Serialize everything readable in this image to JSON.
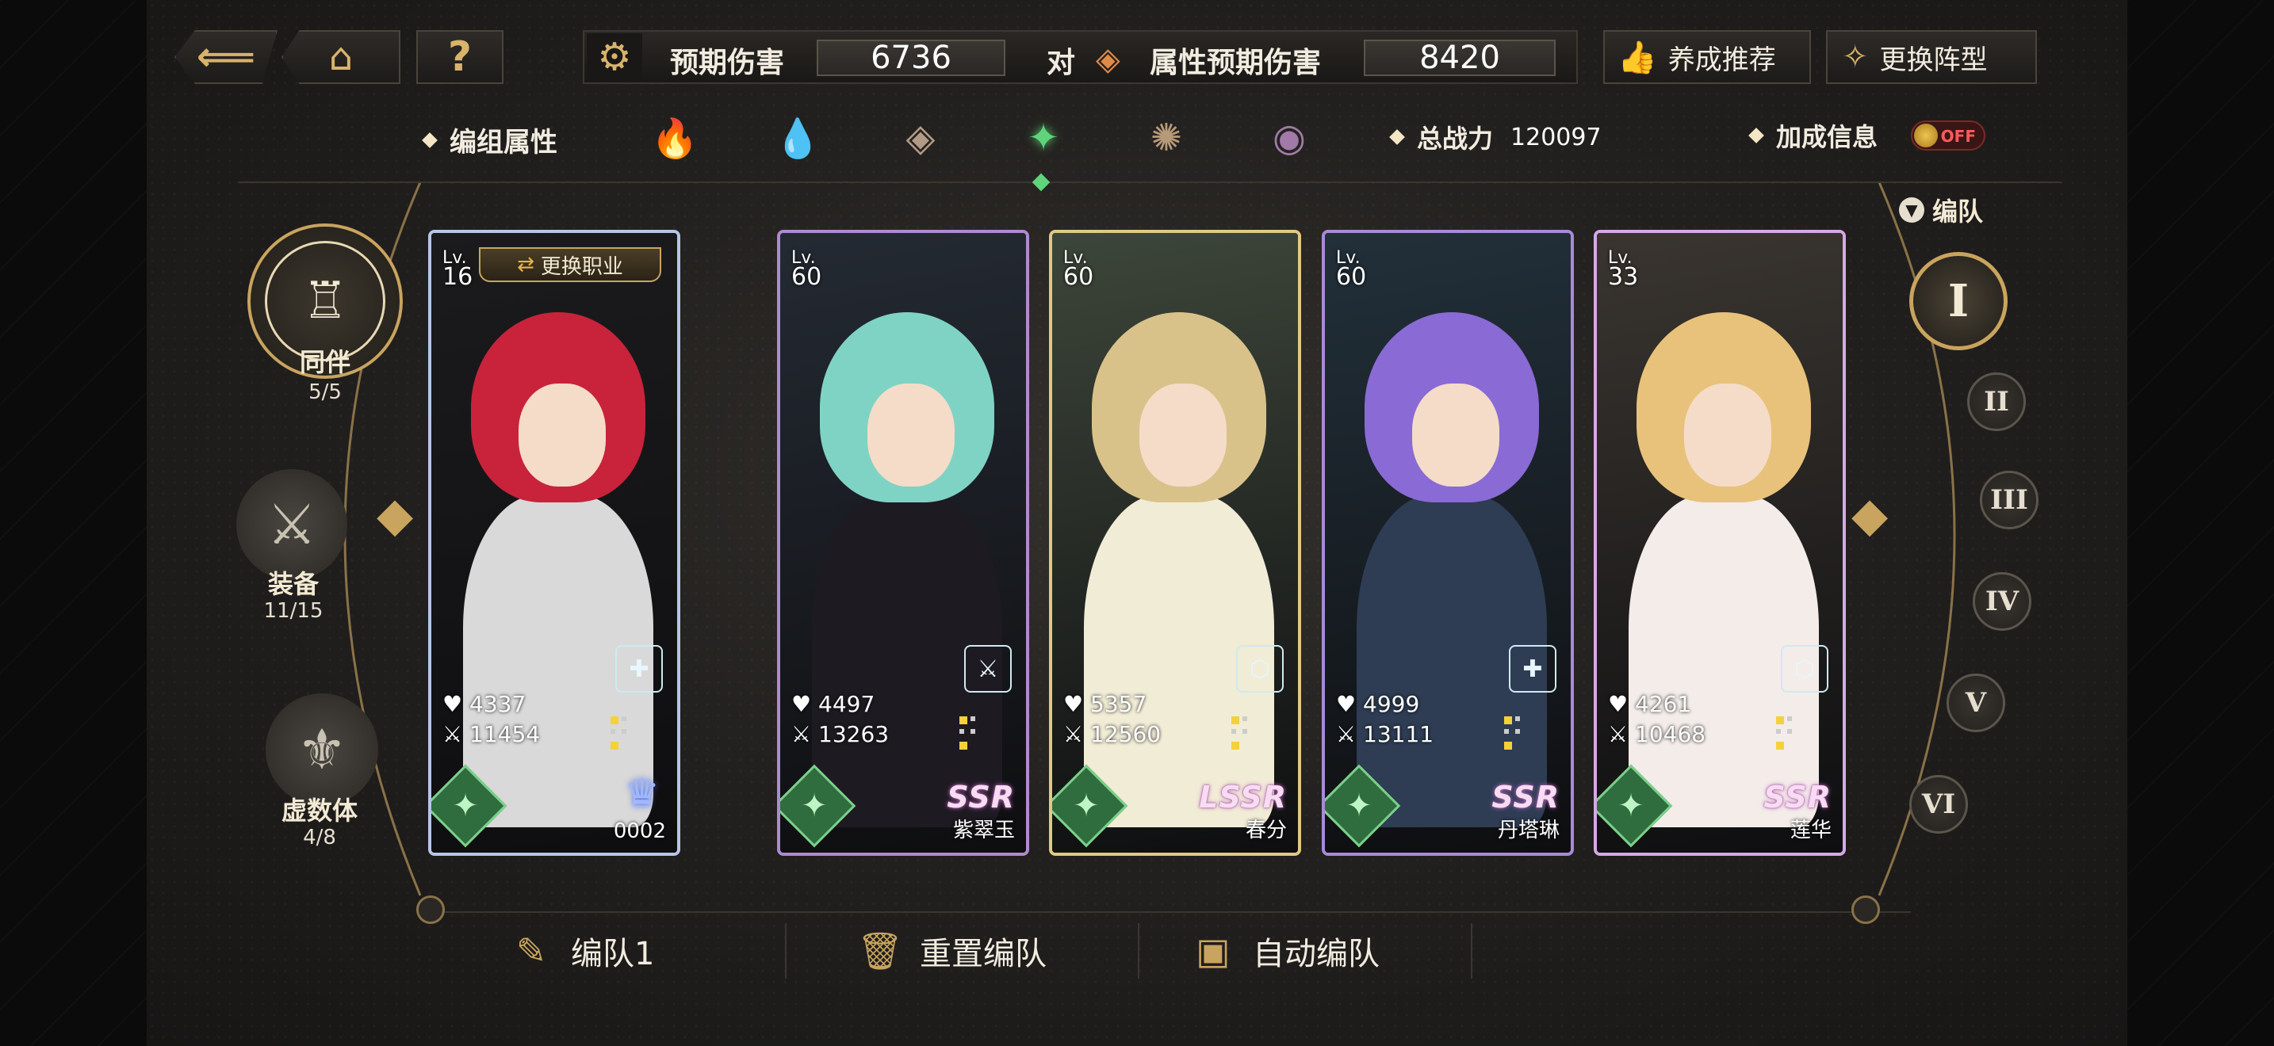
{
  "topbar": {
    "back_label": "",
    "home_label": "",
    "help_label": "?",
    "expected_damage_label": "预期伤害",
    "expected_damage_value": "6736",
    "versus_label": "对",
    "attr_damage_label": "属性预期伤害",
    "attr_damage_value": "8420",
    "recommend_label": "养成推荐",
    "change_formation_label": "更换阵型"
  },
  "attrbar": {
    "group_attr_label": "编组属性",
    "elements": [
      {
        "name": "fire",
        "glyph": "🔥",
        "color": "#c0726a"
      },
      {
        "name": "water",
        "glyph": "💧",
        "color": "#8aa3c2"
      },
      {
        "name": "earth",
        "glyph": "◈",
        "color": "#b39a86"
      },
      {
        "name": "wind",
        "glyph": "✦",
        "color": "#5fd47a"
      },
      {
        "name": "light",
        "glyph": "✺",
        "color": "#b69a7a"
      },
      {
        "name": "dark",
        "glyph": "◉",
        "color": "#a17aa8"
      }
    ],
    "total_power_label": "总战力",
    "total_power_value": "120097",
    "bonus_info_label": "加成信息",
    "toggle_label": "OFF"
  },
  "left_menu": {
    "companion_label": "同伴",
    "companion_count": "5/5",
    "equipment_label": "装备",
    "equipment_count": "11/15",
    "virtual_label": "虚数体",
    "virtual_count": "4/8"
  },
  "right_menu": {
    "team_label": "编队",
    "teams": [
      "I",
      "II",
      "III",
      "IV",
      "V",
      "VI"
    ]
  },
  "cards": [
    {
      "lv_label": "Lv.",
      "level": "16",
      "hp": "4337",
      "atk": "11454",
      "name": "0002",
      "rarity": "",
      "change_job": "更换职业",
      "hair": "#c8233b",
      "outfit": "#d9d9d9",
      "bg": "#1b1b1d",
      "border": "#b7c6e6",
      "class_glyph": "✚"
    },
    {
      "lv_label": "Lv.",
      "level": "60",
      "hp": "4497",
      "atk": "13263",
      "name": "紫翠玉",
      "rarity": "SSR",
      "hair": "#7fd3c4",
      "outfit": "#1e1a22",
      "bg": "#242a33",
      "border": "#b08ad0",
      "class_glyph": "⚔"
    },
    {
      "lv_label": "Lv.",
      "level": "60",
      "hp": "5357",
      "atk": "12560",
      "name": "春分",
      "rarity": "LSSR",
      "hair": "#d9c28a",
      "outfit": "#f1ecd6",
      "bg": "#3d463a",
      "border": "#e0c985",
      "class_glyph": "⬡"
    },
    {
      "lv_label": "Lv.",
      "level": "60",
      "hp": "4999",
      "atk": "13111",
      "name": "丹塔琳",
      "rarity": "SSR",
      "hair": "#8a6ad4",
      "outfit": "#2e3d54",
      "bg": "#22303a",
      "border": "#a88ad8",
      "class_glyph": "✚"
    },
    {
      "lv_label": "Lv.",
      "level": "33",
      "hp": "4261",
      "atk": "10468",
      "name": "莲华",
      "rarity": "SSR",
      "hair": "#e8c27a",
      "outfit": "#f3ece8",
      "bg": "#3a3530",
      "border": "#d6a8e6",
      "class_glyph": "⬡"
    }
  ],
  "bottom": {
    "team1_label": "编队1",
    "reset_label": "重置编队",
    "auto_label": "自动编队"
  }
}
